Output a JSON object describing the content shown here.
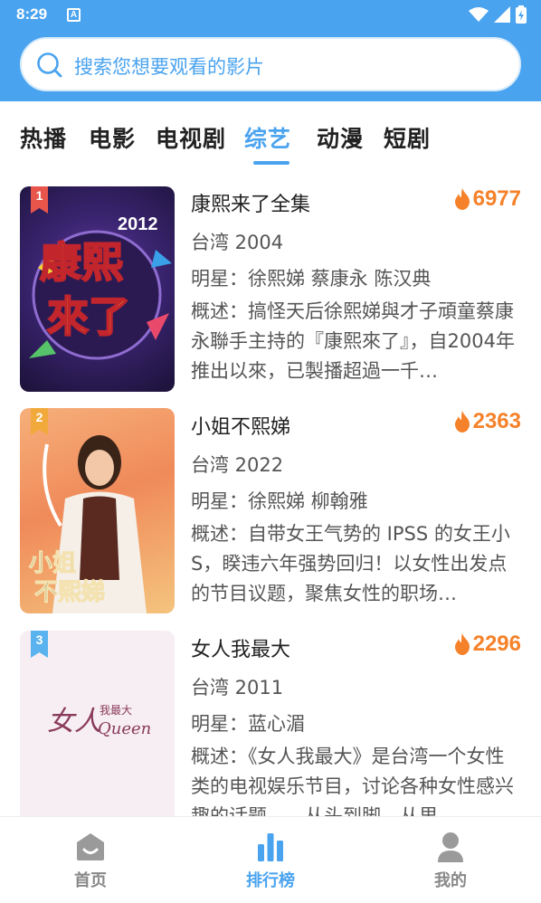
{
  "status": {
    "time": "8:29",
    "a_badge": "A"
  },
  "search": {
    "placeholder": "搜索您想要观看的影片"
  },
  "tabs": [
    {
      "label": "热播"
    },
    {
      "label": "电影"
    },
    {
      "label": "电视剧"
    },
    {
      "label": "综艺",
      "active": true
    },
    {
      "label": "动漫"
    },
    {
      "label": "短剧"
    }
  ],
  "items": [
    {
      "rank": "1",
      "title": "康熙来了全集",
      "heat": "6977",
      "region_year": "台湾 2004",
      "cast": "明星：徐熙娣 蔡康永 陈汉典",
      "desc": "概述：搞怪天后徐熙娣與才子頑童蔡康永聯手主持的『康熙來了』，自2004年推出以來，已製播超過一千…",
      "poster_text": "康熙來了",
      "poster_year": "2012"
    },
    {
      "rank": "2",
      "title": "小姐不熙娣",
      "heat": "2363",
      "region_year": "台湾 2022",
      "cast": "明星：徐熙娣 柳翰雅",
      "desc": "概述：自带女王气势的 IPSS 的女王小S，睽违六年强势回归！以女性出发点的节目议题，聚焦女性的职场…",
      "poster_text": "小姐不熙娣"
    },
    {
      "rank": "3",
      "title": "女人我最大",
      "heat": "2296",
      "region_year": "台湾 2011",
      "cast": "明星：蓝心湄",
      "desc": "概述：《女人我最大》是台湾一个女性类的电视娱乐节目，讨论各种女性感兴趣的话题——从头到脚，从里…",
      "poster_text": "女人我最大",
      "poster_sub": "Queen"
    }
  ],
  "nav": [
    {
      "label": "首页",
      "icon": "home-icon"
    },
    {
      "label": "排行榜",
      "icon": "ranking-icon",
      "active": true
    },
    {
      "label": "我的",
      "icon": "profile-icon"
    }
  ],
  "colors": {
    "accent": "#4aa3ef",
    "heat": "#f5822a",
    "rank1": "#e8554a",
    "rank2": "#f2a93b",
    "rank3": "#5ab3ee"
  }
}
